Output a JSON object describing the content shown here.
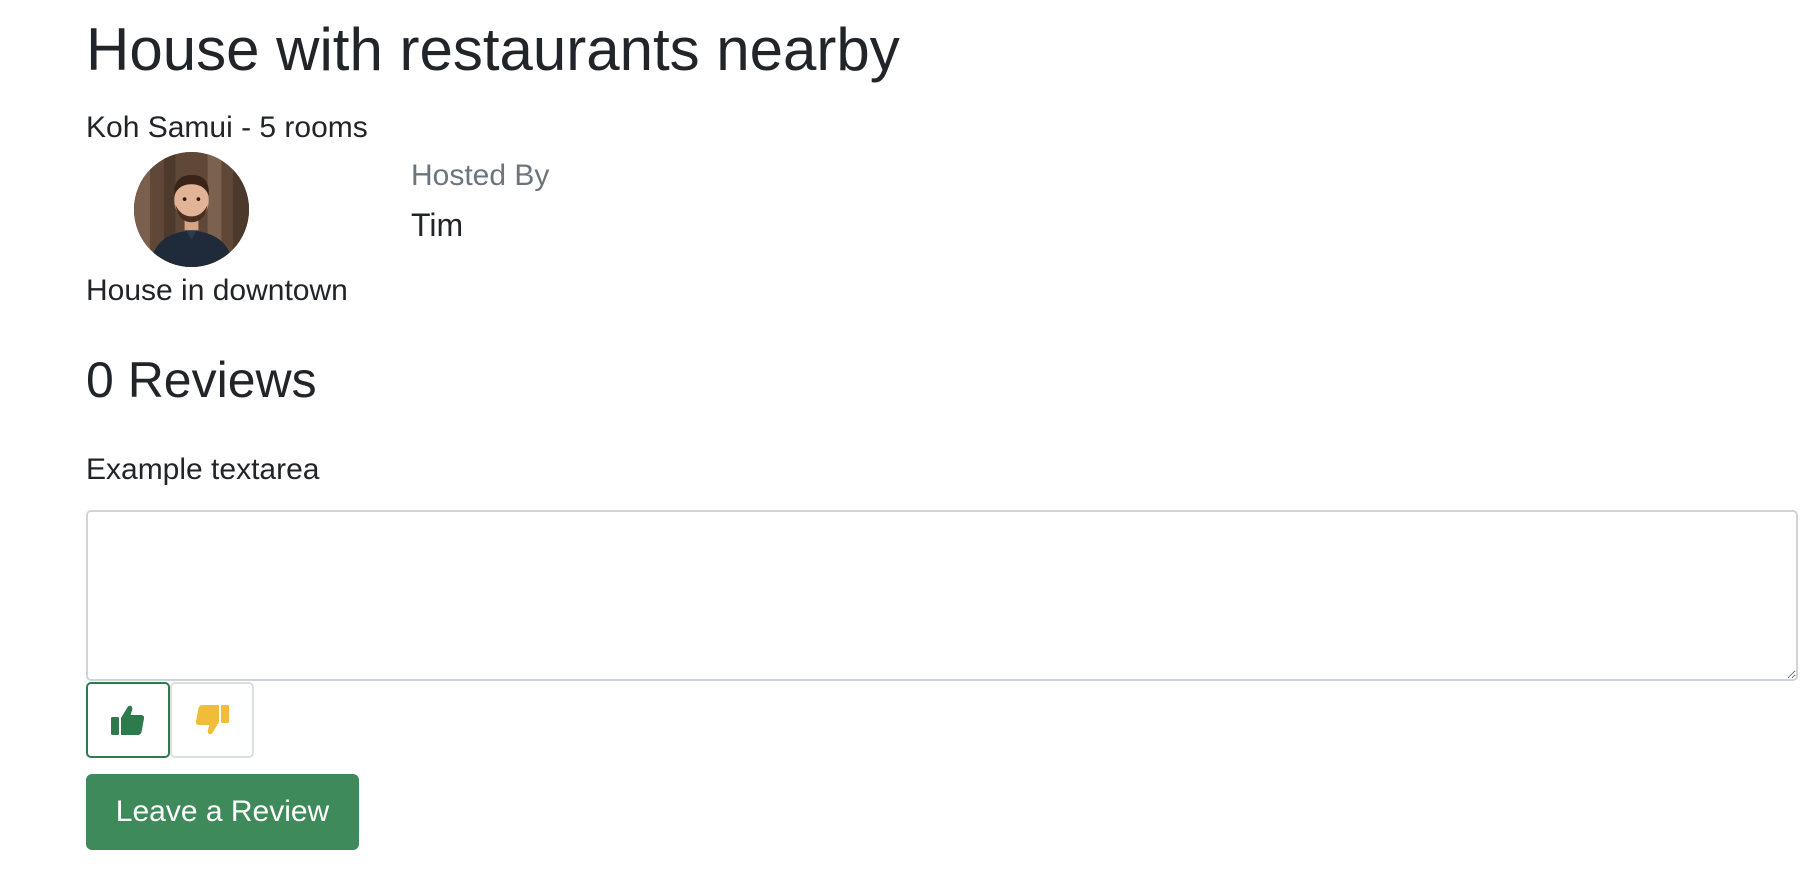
{
  "listing": {
    "title": "House with restaurants nearby",
    "location_rooms": "Koh Samui - 5 rooms",
    "description": "House in downtown"
  },
  "host": {
    "label": "Hosted By",
    "name": "Tim",
    "avatar_icon": "host-avatar-photo"
  },
  "reviews": {
    "heading": "0 Reviews",
    "textarea_label": "Example textarea",
    "textarea_value": "",
    "thumbs_up_icon": "thumbs-up-icon",
    "thumbs_down_icon": "thumbs-down-icon",
    "submit_label": "Leave a Review"
  },
  "colors": {
    "accent_green": "#3e8a5a",
    "thumbs_up": "#2d7a4c",
    "thumbs_down": "#f0bd3a",
    "muted_text": "#6c757d"
  }
}
